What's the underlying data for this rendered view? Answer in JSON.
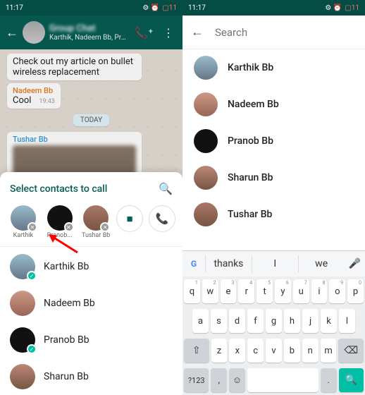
{
  "left": {
    "status": {
      "time": "11:17",
      "signal": "📶",
      "battery": "11"
    },
    "header": {
      "title": "Group Chat",
      "subtitle": "Karthik, Nadeem Bb, Pranob Bb,..."
    },
    "chat": {
      "msg1": {
        "text": "Check out my article on bullet wireless replacement"
      },
      "msg2": {
        "sender": "Nadeem Bb",
        "text": "Cool",
        "time": "19:43"
      },
      "day": "TODAY",
      "msg3": {
        "sender": "Tushar Bb"
      }
    },
    "sheet": {
      "title": "Select contacts to call",
      "selected": [
        {
          "name": "Karthik"
        },
        {
          "name": "Pranob..."
        },
        {
          "name": "Tushar Bb"
        }
      ],
      "contacts": [
        {
          "name": "Karthik Bb",
          "checked": true
        },
        {
          "name": "Nadeem Bb",
          "checked": false
        },
        {
          "name": "Pranob Bb",
          "checked": true
        },
        {
          "name": "Sharun Bb",
          "checked": false
        }
      ]
    }
  },
  "right": {
    "status": {
      "time": "11:17",
      "battery": "11"
    },
    "search": {
      "placeholder": "Search"
    },
    "contacts": [
      {
        "name": "Karthik Bb"
      },
      {
        "name": "Nadeem Bb"
      },
      {
        "name": "Pranob Bb"
      },
      {
        "name": "Sharun Bb"
      },
      {
        "name": "Tushar Bb"
      }
    ],
    "keyboard": {
      "suggestions": [
        "thanks",
        "I",
        "we"
      ],
      "row1": [
        [
          "q",
          "1"
        ],
        [
          "w",
          "2"
        ],
        [
          "e",
          "3"
        ],
        [
          "r",
          "4"
        ],
        [
          "t",
          "5"
        ],
        [
          "y",
          "6"
        ],
        [
          "u",
          "7"
        ],
        [
          "i",
          "8"
        ],
        [
          "o",
          "9"
        ],
        [
          "p",
          "0"
        ]
      ],
      "row2": [
        "a",
        "s",
        "d",
        "f",
        "g",
        "h",
        "j",
        "k",
        "l"
      ],
      "row3": [
        "z",
        "x",
        "c",
        "v",
        "b",
        "n",
        "m"
      ],
      "sym": "?123",
      "comma": ",",
      "period": "."
    }
  }
}
